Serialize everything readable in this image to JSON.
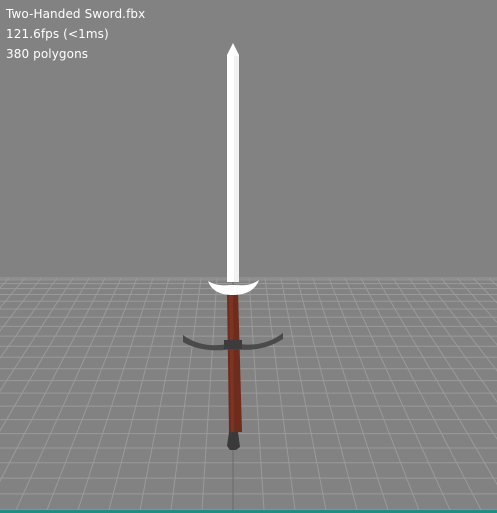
{
  "viewer": {
    "file_name": "Two-Handed Sword.fbx",
    "fps": "121.6fps (<1ms)",
    "polygons": "380 polygons"
  },
  "scene": {
    "background_color": "#828282",
    "grid_color": "#9a9a9a",
    "accent_color": "#1f8f86",
    "model": "two-handed-sword"
  }
}
